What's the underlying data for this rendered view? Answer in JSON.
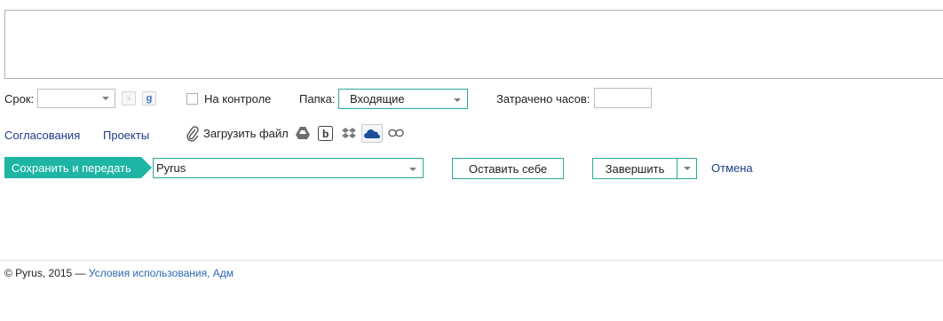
{
  "form": {
    "deadline_label": "Срок:",
    "deadline_value": "",
    "on_control_label": "На контроле",
    "folder_label": "Папка:",
    "folder_value": "Входящие",
    "hours_label": "Затрачено часов:",
    "hours_value": ""
  },
  "links": {
    "approvals": "Согласования",
    "projects": "Проекты",
    "upload_file": "Загрузить файл"
  },
  "icons": {
    "lightning": "lightning-icon",
    "google": "google-calendar-icon",
    "paperclip": "paperclip-icon",
    "google_drive": "google-drive-icon",
    "box": "box-icon",
    "dropbox": "dropbox-icon",
    "onedrive": "onedrive-icon",
    "link": "link-icon"
  },
  "actions": {
    "save_and_send": "Сохранить и передать",
    "recipient_value": "Pyrus",
    "keep_for_self": "Оставить себе",
    "finish": "Завершить",
    "cancel": "Отмена"
  },
  "footer": {
    "copyright": "© Pyrus, 2015 — ",
    "terms_link": "Условия использования, Адм"
  },
  "colors": {
    "accent": "#1fb5a5",
    "link": "#1e3a8a",
    "border": "#2aa89a"
  }
}
